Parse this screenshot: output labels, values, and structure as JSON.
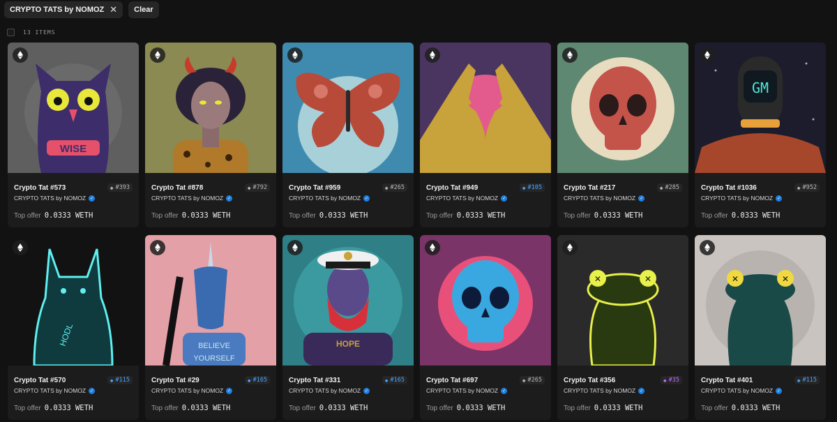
{
  "filter_chip": {
    "label": "CRYPTO TATS by NOMOZ",
    "close_glyph": "✕"
  },
  "clear_label": "Clear",
  "item_count": "13 ITEMS",
  "offer_label": "Top offer",
  "items": [
    {
      "name": "Crypto Tat #573",
      "collection": "CRYPTO TATS by NOMOZ",
      "rank": "#393",
      "rank_color": "#b8b8b8",
      "price": "0.0333 WETH",
      "bg": "#5f5f5f",
      "motif": "owl"
    },
    {
      "name": "Crypto Tat #878",
      "collection": "CRYPTO TATS by NOMOZ",
      "rank": "#792",
      "rank_color": "#b8b8b8",
      "price": "0.0333 WETH",
      "bg": "#8a8a52",
      "motif": "devil"
    },
    {
      "name": "Crypto Tat #959",
      "collection": "CRYPTO TATS by NOMOZ",
      "rank": "#265",
      "rank_color": "#b8b8b8",
      "price": "0.0333 WETH",
      "bg": "#3f8bb0",
      "motif": "butterfly"
    },
    {
      "name": "Crypto Tat #949",
      "collection": "CRYPTO TATS by NOMOZ",
      "rank": "#105",
      "rank_color": "#4aa3ff",
      "price": "0.0333 WETH",
      "bg": "#4a3560",
      "motif": "hands"
    },
    {
      "name": "Crypto Tat #217",
      "collection": "CRYPTO TATS by NOMOZ",
      "rank": "#285",
      "rank_color": "#b8b8b8",
      "price": "0.0333 WETH",
      "bg": "#5f8872",
      "motif": "skull-red"
    },
    {
      "name": "Crypto Tat #1036",
      "collection": "CRYPTO TATS by NOMOZ",
      "rank": "#952",
      "rank_color": "#b8b8b8",
      "price": "0.0333 WETH",
      "bg": "#1c1c2c",
      "motif": "helmet"
    },
    {
      "name": "Crypto Tat #570",
      "collection": "CRYPTO TATS by NOMOZ",
      "rank": "#115",
      "rank_color": "#4aa3ff",
      "price": "0.0333 WETH",
      "bg": "#121212",
      "motif": "dog"
    },
    {
      "name": "Crypto Tat #29",
      "collection": "CRYPTO TATS by NOMOZ",
      "rank": "#165",
      "rank_color": "#4aa3ff",
      "price": "0.0333 WETH",
      "bg": "#e3a0a6",
      "motif": "unicorn"
    },
    {
      "name": "Crypto Tat #331",
      "collection": "CRYPTO TATS by NOMOZ",
      "rank": "#165",
      "rank_color": "#4aa3ff",
      "price": "0.0333 WETH",
      "bg": "#2f7f86",
      "motif": "sailor"
    },
    {
      "name": "Crypto Tat #697",
      "collection": "CRYPTO TATS by NOMOZ",
      "rank": "#265",
      "rank_color": "#b8b8b8",
      "price": "0.0333 WETH",
      "bg": "#7a3468",
      "motif": "skull-blue"
    },
    {
      "name": "Crypto Tat #356",
      "collection": "CRYPTO TATS by NOMOZ",
      "rank": "#35",
      "rank_color": "#c06cff",
      "price": "0.0333 WETH",
      "bg": "#2a2a2a",
      "motif": "frog-yellow"
    },
    {
      "name": "Crypto Tat #401",
      "collection": "CRYPTO TATS by NOMOZ",
      "rank": "#115",
      "rank_color": "#4aa3ff",
      "price": "0.0333 WETH",
      "bg": "#c9c4c0",
      "motif": "frog-teal"
    }
  ]
}
